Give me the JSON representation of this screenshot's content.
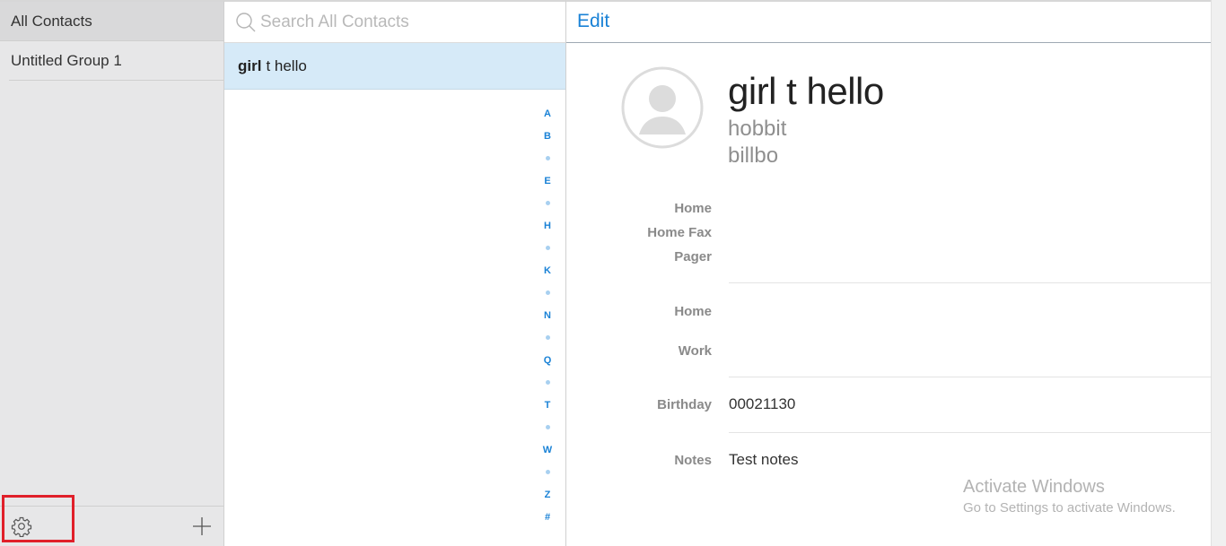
{
  "groups": {
    "items": [
      {
        "label": "All Contacts",
        "selected": true
      },
      {
        "label": "Untitled Group 1",
        "selected": false
      }
    ],
    "footer": {
      "settings_icon": "gear-icon",
      "add_icon": "plus-icon"
    }
  },
  "list": {
    "search": {
      "placeholder": "Search All Contacts",
      "value": ""
    },
    "contacts": [
      {
        "last": "girl",
        "rest": "t hello"
      }
    ],
    "index": [
      "A",
      "B",
      "•",
      "E",
      "•",
      "H",
      "•",
      "K",
      "•",
      "N",
      "•",
      "Q",
      "•",
      "T",
      "•",
      "W",
      "•",
      "Z",
      "#"
    ]
  },
  "detail": {
    "edit_label": "Edit",
    "name": "girl t hello",
    "line1": "hobbit",
    "line2": "billbo",
    "fields": {
      "phone_home": "Home",
      "phone_home_fax": "Home Fax",
      "phone_pager": "Pager",
      "address_home": "Home",
      "address_work": "Work",
      "birthday_label": "Birthday",
      "birthday_value": "00021130",
      "notes_label": "Notes",
      "notes_value": "Test notes"
    }
  },
  "watermark": {
    "line1": "Activate Windows",
    "line2": "Go to Settings to activate Windows."
  },
  "colors": {
    "accent": "#1a82d6",
    "selected_row": "#d6eaf8",
    "sidebar_bg": "#e7e7e8",
    "highlight": "#e0202a"
  }
}
